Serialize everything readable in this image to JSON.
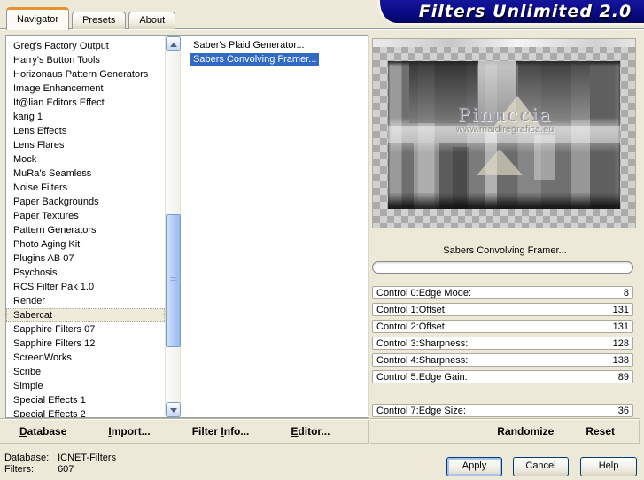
{
  "window": {
    "title": "Filters Unlimited 2.0"
  },
  "colors": {
    "dialog_bg": "#ECE9D8",
    "banner_navy": "#0A0A87",
    "tab_accent_orange": "#E5932F",
    "selection_blue": "#316AC5",
    "category_selected_bg": "#EFEBDA",
    "checker_light": "#D2D2D2",
    "checker_dark": "#ABABAB"
  },
  "tabs": [
    {
      "label": "Navigator",
      "cls": "active"
    },
    {
      "label": "Presets"
    },
    {
      "label": "About"
    }
  ],
  "category_list": {
    "items": [
      {
        "label": "Greg's Factory Output"
      },
      {
        "label": "Harry's Button Tools"
      },
      {
        "label": "Horizonaus Pattern Generators"
      },
      {
        "label": "Image Enhancement"
      },
      {
        "label": "It@lian Editors Effect"
      },
      {
        "label": "kang 1"
      },
      {
        "label": "Lens Effects"
      },
      {
        "label": "Lens Flares"
      },
      {
        "label": "Mock"
      },
      {
        "label": "MuRa's Seamless"
      },
      {
        "label": "Noise Filters"
      },
      {
        "label": "Paper Backgrounds"
      },
      {
        "label": "Paper Textures"
      },
      {
        "label": "Pattern Generators"
      },
      {
        "label": "Photo Aging Kit"
      },
      {
        "label": "Plugins AB 07"
      },
      {
        "label": "Psychosis"
      },
      {
        "label": "RCS Filter Pak 1.0"
      },
      {
        "label": "Render"
      },
      {
        "label": "Sabercat",
        "cls": "selected"
      },
      {
        "label": "Sapphire Filters 07"
      },
      {
        "label": "Sapphire Filters 12"
      },
      {
        "label": "ScreenWorks"
      },
      {
        "label": "Scribe"
      },
      {
        "label": "Simple"
      },
      {
        "label": "Special Effects 1"
      },
      {
        "label": "Special Effects 2"
      }
    ]
  },
  "filter_list": {
    "items": [
      {
        "label": "Saber's Plaid Generator..."
      },
      {
        "label": "Sabers Convolving Framer...",
        "cls": "selected"
      }
    ]
  },
  "preview": {
    "caption": "Sabers Convolving Framer...",
    "progress_percent": 0
  },
  "watermark": {
    "name": "Pinuccia",
    "url": "www.maidiregrafica.eu"
  },
  "controls": [
    {
      "label": "Control 0:Edge Mode:",
      "value": "8"
    },
    {
      "label": "Control 1:Offset:",
      "value": "131"
    },
    {
      "label": "Control 2:Offset:",
      "value": "131"
    },
    {
      "label": "Control 3:Sharpness:",
      "value": "128"
    },
    {
      "label": "Control 4:Sharpness:",
      "value": "138"
    },
    {
      "label": "Control 5:Edge Gain:",
      "value": "89"
    },
    {
      "label": "",
      "value": "",
      "cls": "empty"
    },
    {
      "label": "Control 7:Edge Size:",
      "value": "36"
    }
  ],
  "toolbar_left": {
    "items": [
      {
        "pre": "",
        "mn": "D",
        "post": "atabase"
      },
      {
        "pre": "",
        "mn": "I",
        "post": "mport..."
      },
      {
        "pre": "Filter ",
        "mn": "I",
        "post": "nfo..."
      },
      {
        "pre": "",
        "mn": "E",
        "post": "ditor..."
      }
    ]
  },
  "toolbar_right": {
    "randomize_label": "Randomize",
    "reset_label": "Reset"
  },
  "status": {
    "database_label": "Database:",
    "database_value": "ICNET-Filters",
    "filters_label": "Filters:",
    "filters_value": "607"
  },
  "buttons": {
    "apply_label": "Apply",
    "cancel_label": "Cancel",
    "help_label": "Help"
  }
}
